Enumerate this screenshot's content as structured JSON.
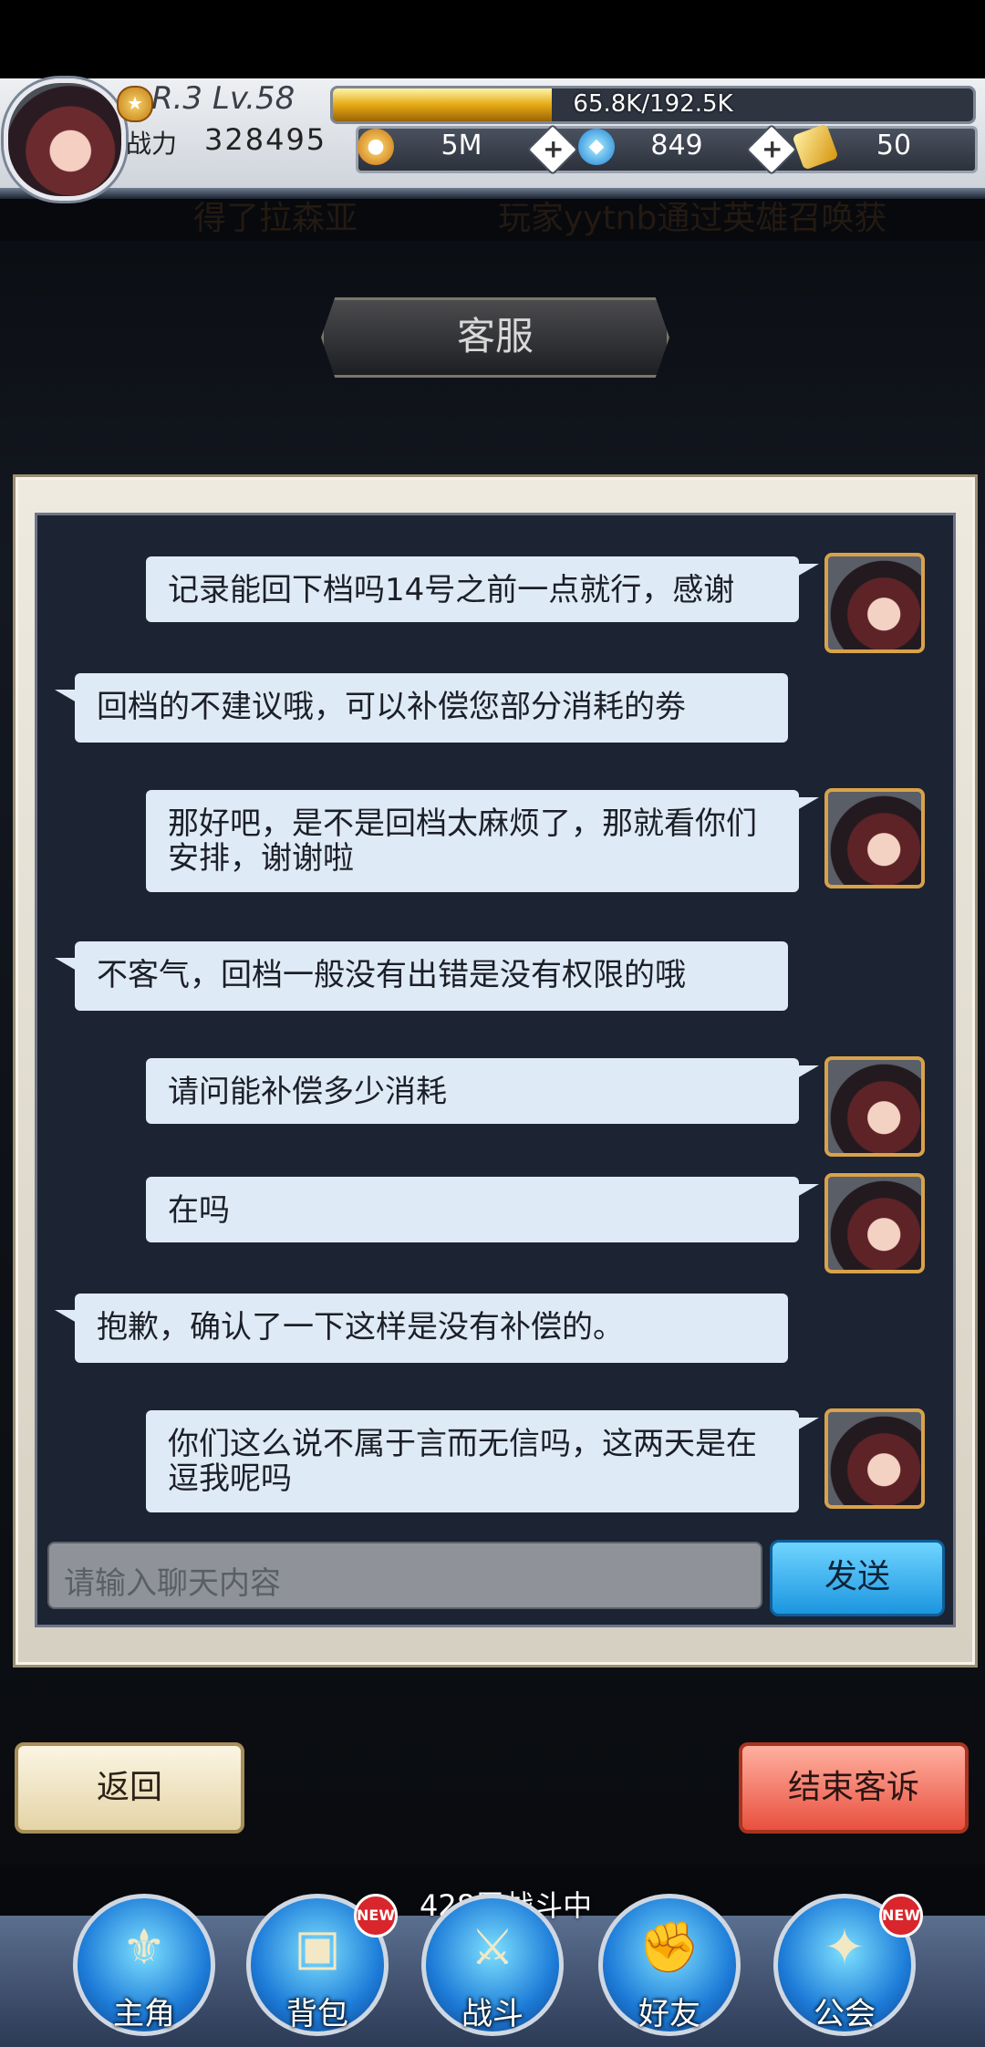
{
  "header": {
    "rank_level": "R.3 Lv.58",
    "power_label": "战力",
    "power_value": "328495",
    "exp_text": "65.8K/192.5K",
    "exp_fraction": 0.342,
    "gold": "5M",
    "gems": "849",
    "tickets": "50",
    "plus": "+"
  },
  "ticker": {
    "left_fragment": "得了拉森亚",
    "right_fragment": "玩家yytnb通过英雄召唤获"
  },
  "page_title": "客服",
  "messages": [
    {
      "side": "right",
      "text": "记录能回下档吗14号之前一点就行，感谢"
    },
    {
      "side": "left",
      "text": "回档的不建议哦，可以补偿您部分消耗的劵"
    },
    {
      "side": "right",
      "text": "那好吧，是不是回档太麻烦了，那就看你们安排，谢谢啦"
    },
    {
      "side": "left",
      "text": "不客气，回档一般没有出错是没有权限的哦"
    },
    {
      "side": "right",
      "text": "请问能补偿多少消耗"
    },
    {
      "side": "right",
      "text": "在吗"
    },
    {
      "side": "left",
      "text": "抱歉，确认了一下这样是没有补偿的。"
    },
    {
      "side": "right",
      "text": "你们这么说不属于言而无信吗，这两天是在逗我呢吗"
    }
  ],
  "chat_input": {
    "placeholder": "请输入聊天内容"
  },
  "send_label": "发送",
  "back_label": "返回",
  "end_label": "结束客诉",
  "floor_status": "428层战斗中",
  "nav": [
    {
      "label": "主角",
      "new": false
    },
    {
      "label": "背包",
      "new": true
    },
    {
      "label": "战斗",
      "new": false
    },
    {
      "label": "好友",
      "new": false
    },
    {
      "label": "公会",
      "new": true
    }
  ],
  "new_badge": "NEW",
  "colors": {
    "bubble": "#dfeaf7",
    "chat_bg": "#1c2333",
    "send": "#1c96e0",
    "end": "#e9503f"
  }
}
